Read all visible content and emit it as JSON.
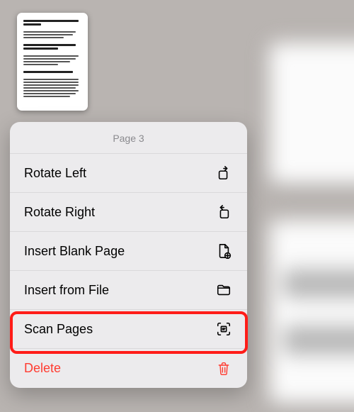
{
  "menu": {
    "header": "Page 3",
    "items": [
      {
        "label": "Rotate Left",
        "icon_name": "rotate-left-icon",
        "destructive": false
      },
      {
        "label": "Rotate Right",
        "icon_name": "rotate-right-icon",
        "destructive": false
      },
      {
        "label": "Insert Blank Page",
        "icon_name": "blank-page-icon",
        "destructive": false
      },
      {
        "label": "Insert from File",
        "icon_name": "folder-icon",
        "destructive": false
      },
      {
        "label": "Scan Pages",
        "icon_name": "scan-icon",
        "destructive": false
      },
      {
        "label": "Delete",
        "icon_name": "trash-icon",
        "destructive": true
      }
    ]
  },
  "highlighted_item_index": 4
}
